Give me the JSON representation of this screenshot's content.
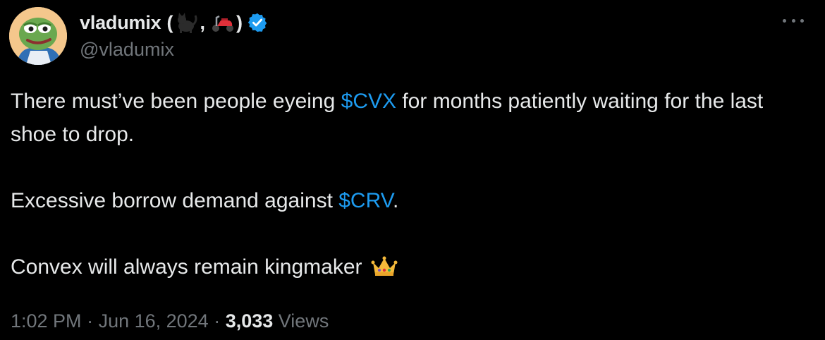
{
  "author": {
    "display_name": "vladumix",
    "name_open": "(",
    "name_comma": ",",
    "name_close": ")",
    "name_emojis": [
      "black-cat-emoji",
      "scooter-emoji"
    ],
    "handle": "@vladumix",
    "verified": true,
    "avatar": "pepe-frog-avatar"
  },
  "tweet": {
    "line1_before": "There must’ve been people eyeing ",
    "line1_cashtag": "$CVX",
    "line1_after": " for months patiently waiting for the last shoe to drop.",
    "line2_before": "Excessive borrow demand against ",
    "line2_cashtag": "$CRV",
    "line2_after": ".",
    "line3_text": "Convex will always remain kingmaker ",
    "line3_emoji": "crown-emoji"
  },
  "meta": {
    "time": "1:02 PM",
    "sep1": " · ",
    "date": "Jun 16, 2024",
    "sep2": " · ",
    "views_count": "3,033",
    "views_label": " Views"
  },
  "colors": {
    "background": "#000000",
    "text": "#e7e9ea",
    "secondary": "#71767b",
    "accent": "#1d9bf0"
  }
}
